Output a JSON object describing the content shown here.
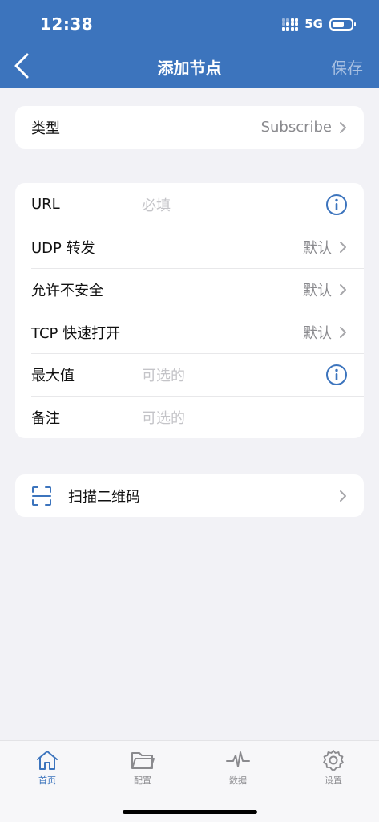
{
  "status_bar": {
    "time": "12:38",
    "network": "5G"
  },
  "nav": {
    "title": "添加节点",
    "save_label": "保存"
  },
  "type_row": {
    "label": "类型",
    "value": "Subscribe"
  },
  "form": {
    "url": {
      "label": "URL",
      "placeholder": "必填"
    },
    "udp": {
      "label": "UDP 转发",
      "value": "默认"
    },
    "insecure": {
      "label": "允许不安全",
      "value": "默认"
    },
    "tfo": {
      "label": "TCP 快速打开",
      "value": "默认"
    },
    "max": {
      "label": "最大值",
      "placeholder": "可选的"
    },
    "remark": {
      "label": "备注",
      "placeholder": "可选的"
    }
  },
  "scan": {
    "label": "扫描二维码"
  },
  "tabbar": {
    "home": "首页",
    "config": "配置",
    "data": "数据",
    "settings": "设置"
  },
  "colors": {
    "accent": "#3c74bd",
    "background": "#f2f2f6",
    "card": "#ffffff"
  }
}
